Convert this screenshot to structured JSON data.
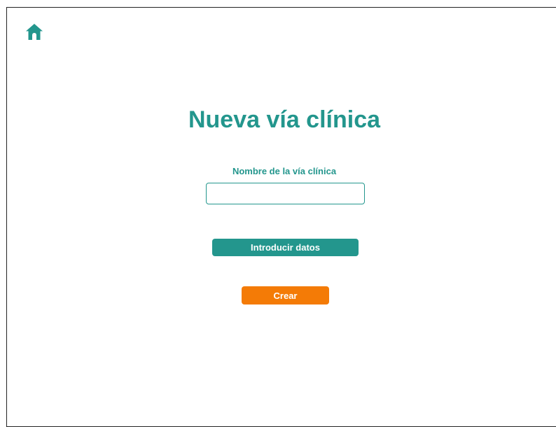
{
  "header": {
    "home_icon": "home-icon"
  },
  "page": {
    "title": "Nueva vía clínica"
  },
  "form": {
    "name_label": "Nombre de la vía clínica",
    "name_value": "",
    "name_placeholder": ""
  },
  "actions": {
    "enter_data_label": "Introducir datos",
    "create_label": "Crear"
  },
  "colors": {
    "primary": "#23968d",
    "accent": "#f47b06",
    "background": "#ffffff",
    "frame_border": "#222222"
  }
}
